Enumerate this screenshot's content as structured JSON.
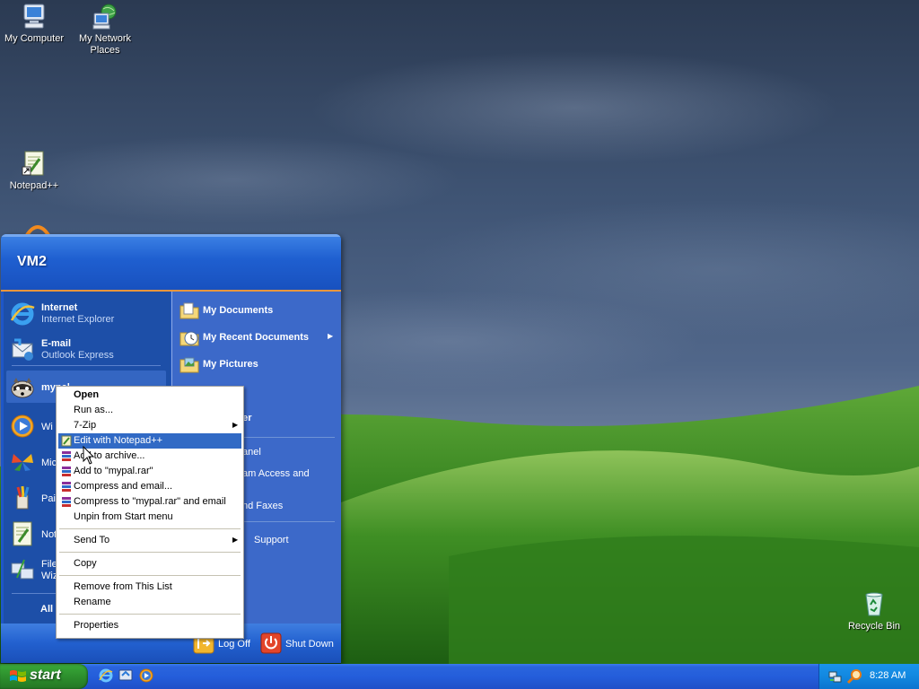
{
  "desktop": {
    "icons": [
      {
        "name": "My Computer"
      },
      {
        "name": "My Network Places"
      },
      {
        "name": "Notepad++"
      },
      {
        "name": "Recycle Bin"
      }
    ]
  },
  "start_menu": {
    "user_name": "VM2",
    "pinned": [
      {
        "title": "Internet",
        "subtitle": "Internet Explorer"
      },
      {
        "title": "E-mail",
        "subtitle": "Outlook Express"
      },
      {
        "title": "mypal"
      }
    ],
    "recent_programs": [
      "Wi",
      "Mic",
      "Pai",
      "Not",
      "File",
      "Wiz"
    ],
    "all_programs_label": "All",
    "places": [
      {
        "label": "My Documents"
      },
      {
        "label": "My Recent Documents",
        "has_submenu": true
      },
      {
        "label": "My Pictures"
      },
      {
        "label": "c"
      },
      {
        "label": "puter"
      },
      {
        "label": "anel"
      },
      {
        "label": "am Access and"
      },
      {
        "label": "nd Faxes"
      },
      {
        "label": "Support"
      }
    ],
    "log_off_label": "Log Off",
    "shut_down_label": "Shut Down"
  },
  "context_menu": {
    "items": [
      {
        "label": "Open",
        "bold": true
      },
      {
        "label": "Run as..."
      },
      {
        "label": "7-Zip",
        "has_submenu": true
      },
      {
        "label": "Edit with Notepad++",
        "selected": true,
        "icon": "notepad-icon"
      },
      {
        "label": "Add to archive...",
        "icon": "winrar-icon"
      },
      {
        "label": "Add to \"mypal.rar\"",
        "icon": "winrar-icon"
      },
      {
        "label": "Compress and email...",
        "icon": "winrar-icon"
      },
      {
        "label": "Compress to \"mypal.rar\" and email",
        "icon": "winrar-icon"
      },
      {
        "label": "Unpin from Start menu"
      },
      {
        "label": "Send To",
        "has_submenu": true
      },
      {
        "label": "Copy"
      },
      {
        "label": "Remove from This List"
      },
      {
        "label": "Rename"
      },
      {
        "label": "Properties"
      }
    ]
  },
  "taskbar": {
    "start_label": "start",
    "clock": "8:28 AM"
  },
  "colors": {
    "start_menu_blue": "#1d4fa8",
    "places_blue": "#3c69c9",
    "selection_blue": "#316ac5",
    "start_green": "#2b8a2b",
    "tray_blue": "#1288e0",
    "accent_orange": "#e8963d"
  }
}
